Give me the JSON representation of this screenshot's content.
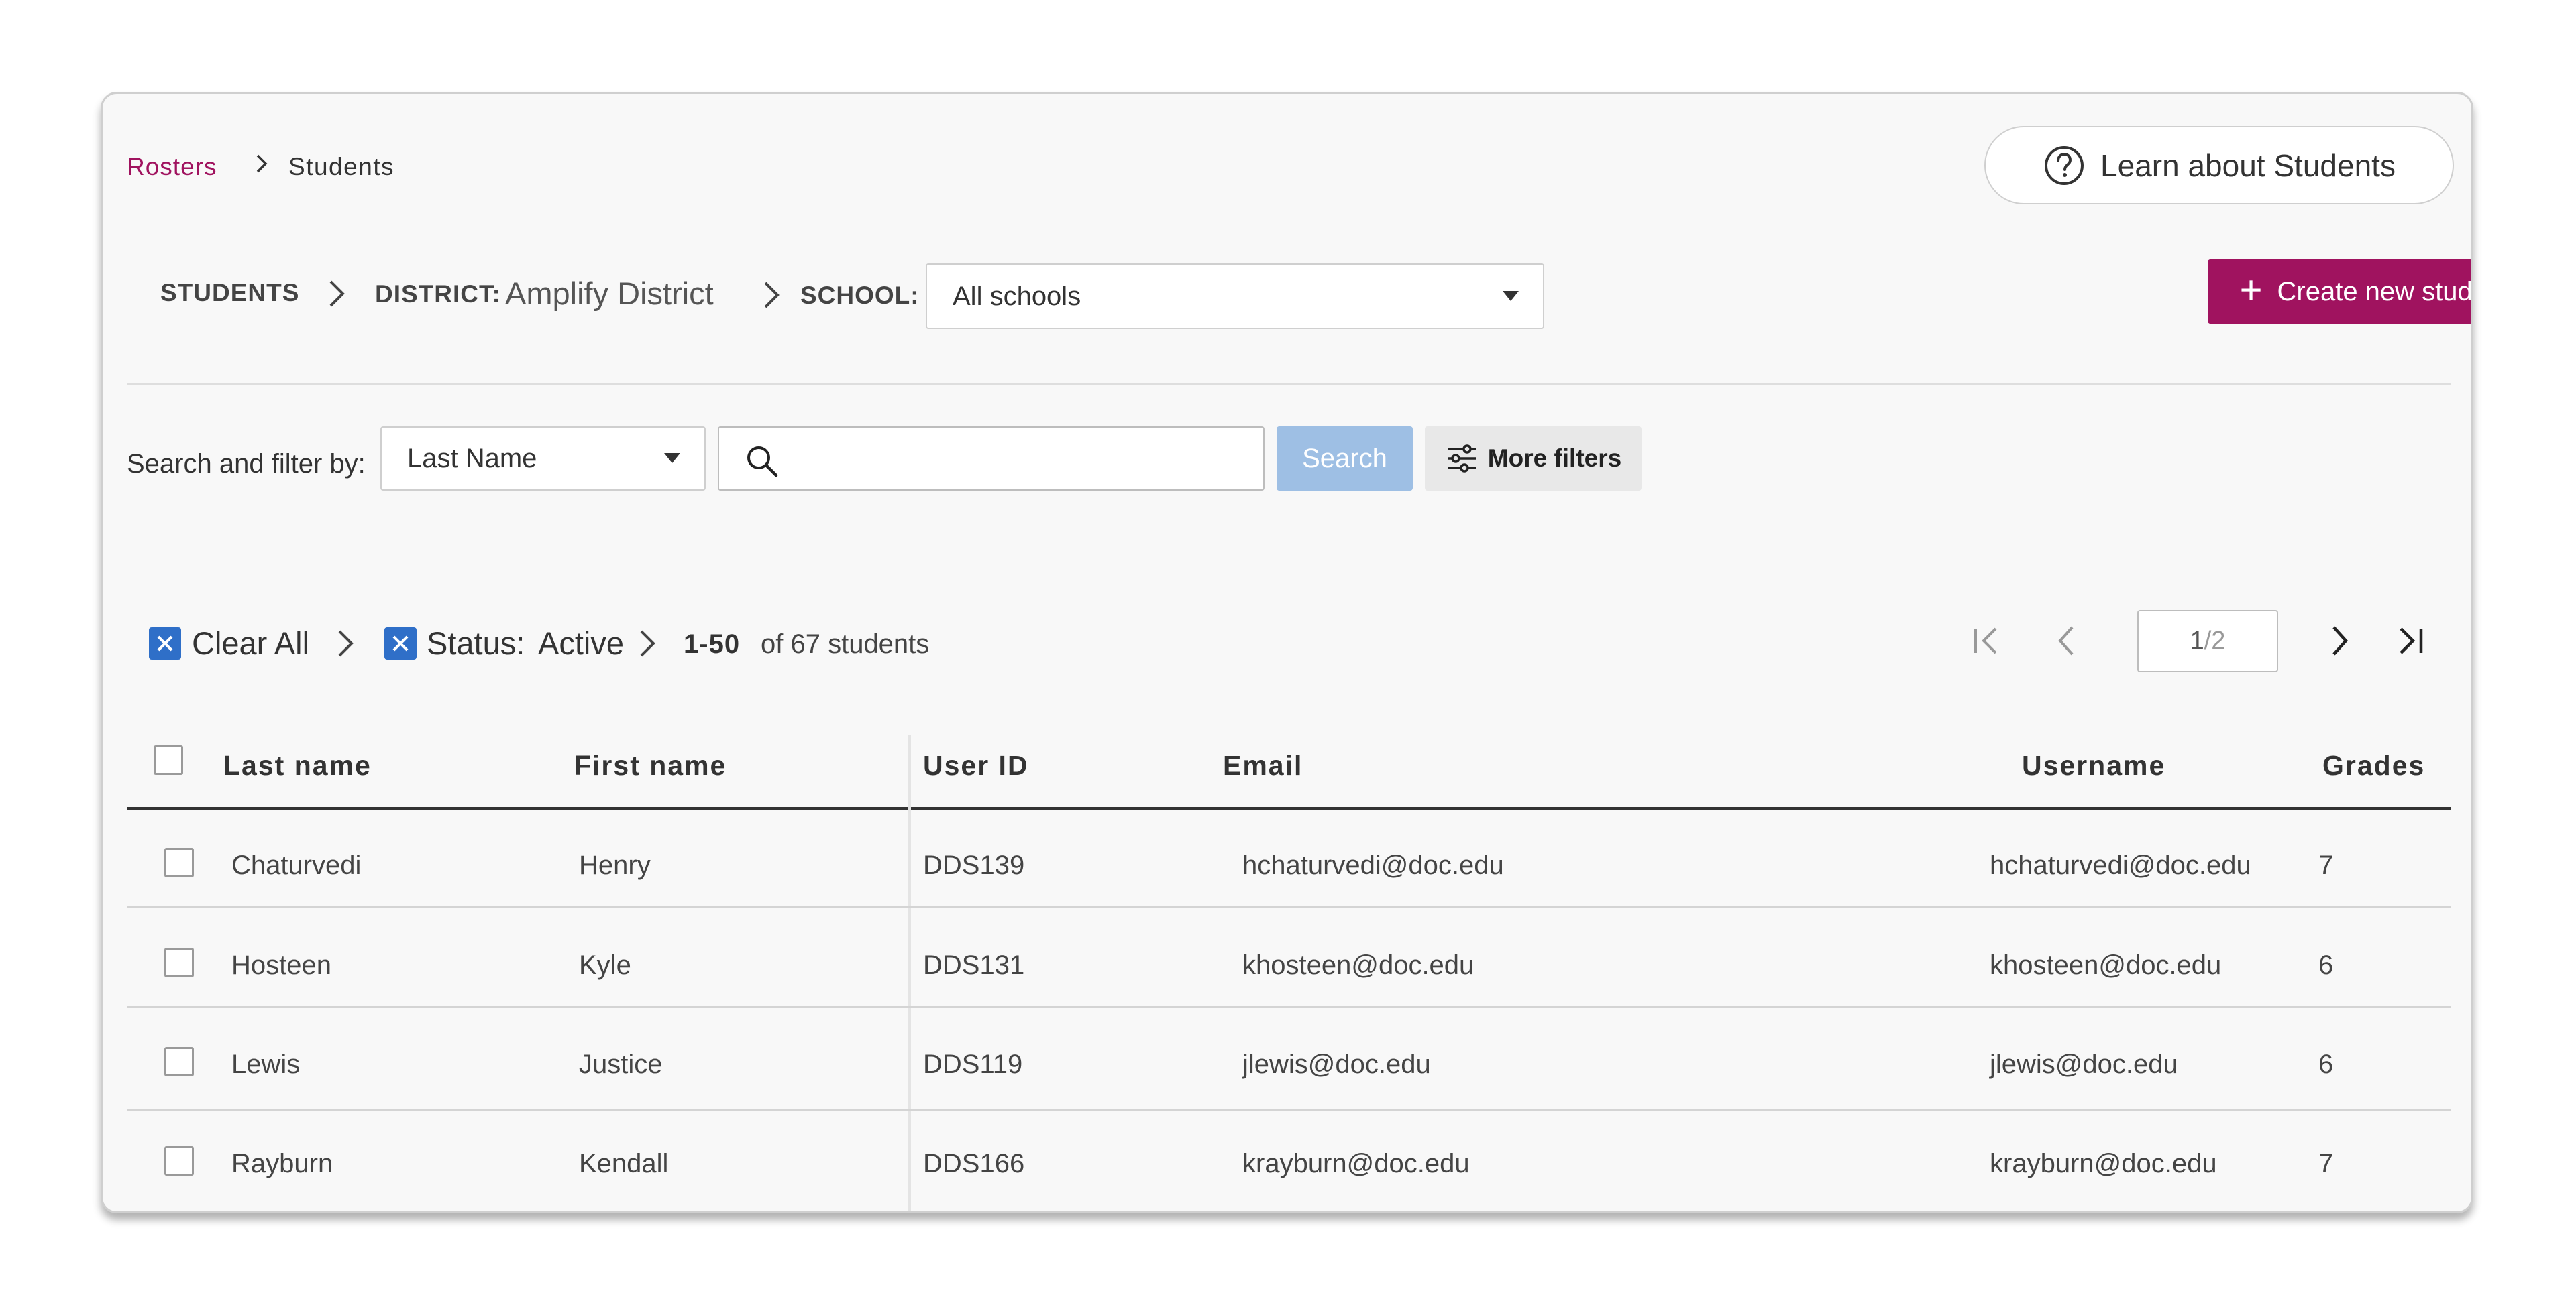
{
  "breadcrumb": {
    "parent": "Rosters",
    "current": "Students"
  },
  "learn_button": {
    "label": "Learn about Students"
  },
  "context": {
    "students_label": "STUDENTS",
    "district_label": "DISTRICT:",
    "district_value": "Amplify District",
    "school_label": "SCHOOL:",
    "school_select": "All schools"
  },
  "create_button": {
    "label": "Create new students"
  },
  "search": {
    "label": "Search and filter by:",
    "field_select": "Last Name",
    "input_value": "",
    "button_label": "Search",
    "more_filters_label": "More filters"
  },
  "filters": {
    "clear_all": "Clear All",
    "status_label": "Status:",
    "status_value": "Active",
    "range": "1-50",
    "total_text": "of 67 students"
  },
  "pagination": {
    "current": "1",
    "total": "/2"
  },
  "table": {
    "headers": [
      "Last name",
      "First name",
      "User ID",
      "Email",
      "Username",
      "Grades"
    ],
    "rows": [
      {
        "last": "Chaturvedi",
        "first": "Henry",
        "user_id": "DDS139",
        "email": "hchaturvedi@doc.edu",
        "username": "hchaturvedi@doc.edu",
        "grade": "7"
      },
      {
        "last": "Hosteen",
        "first": "Kyle",
        "user_id": "DDS131",
        "email": "khosteen@doc.edu",
        "username": "khosteen@doc.edu",
        "grade": "6"
      },
      {
        "last": "Lewis",
        "first": "Justice",
        "user_id": "DDS119",
        "email": "jlewis@doc.edu",
        "username": "jlewis@doc.edu",
        "grade": "6"
      },
      {
        "last": "Rayburn",
        "first": "Kendall",
        "user_id": "DDS166",
        "email": "krayburn@doc.edu",
        "username": "krayburn@doc.edu",
        "grade": "7"
      }
    ]
  },
  "colors": {
    "brand": "#a0135f",
    "primary_blue": "#2f6fc8",
    "search_button": "#9ebfe4"
  }
}
